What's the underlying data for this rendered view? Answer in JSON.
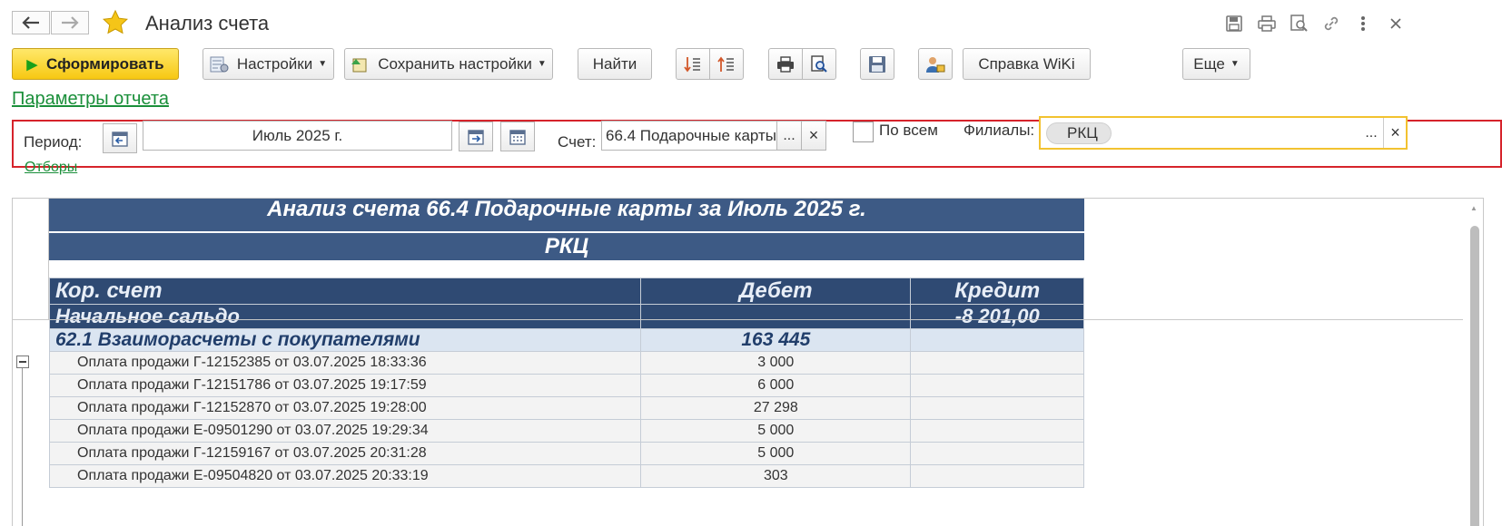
{
  "window": {
    "title": "Анализ счета",
    "title_icons": [
      "save-icon",
      "print-icon",
      "preview-icon",
      "link-icon",
      "more-vertical-icon",
      "close-icon"
    ]
  },
  "toolbar": {
    "generate": "Сформировать",
    "settings": "Настройки",
    "save_settings": "Сохранить настройки",
    "find": "Найти",
    "wiki": "Справка WiKi",
    "more": "Еще"
  },
  "links": {
    "report_params": "Параметры отчета",
    "filters": "Отборы"
  },
  "params": {
    "period_label": "Период:",
    "period_value": "Июль 2025 г.",
    "account_label": "Счет:",
    "account_value": "66.4 Подарочные карты",
    "all_label": "По всем",
    "branches_label": "Филиалы:",
    "branch_tag": "РКЦ",
    "ellipsis": "...",
    "clear": "×"
  },
  "report": {
    "title": "Анализ счета 66.4 Подарочные карты за Июль 2025 г.",
    "subtitle": "РКЦ",
    "columns": [
      "Кор. счет",
      "Дебет",
      "Кредит"
    ],
    "opening_balance": {
      "label": "Начальное сальдо",
      "debit": "",
      "credit": "-8 201,00"
    },
    "group": {
      "label": "62.1 Взаиморасчеты с покупателями",
      "debit": "163 445",
      "credit": ""
    },
    "rows": [
      {
        "label": "Оплата продажи Г-12152385 от 03.07.2025 18:33:36",
        "debit": "3 000",
        "credit": ""
      },
      {
        "label": "Оплата продажи Г-12151786 от 03.07.2025 19:17:59",
        "debit": "6 000",
        "credit": ""
      },
      {
        "label": "Оплата продажи Г-12152870 от 03.07.2025 19:28:00",
        "debit": "27 298",
        "credit": ""
      },
      {
        "label": "Оплата продажи Е-09501290 от 03.07.2025 19:29:34",
        "debit": "5 000",
        "credit": ""
      },
      {
        "label": "Оплата продажи Г-12159167 от 03.07.2025 20:31:28",
        "debit": "5 000",
        "credit": ""
      },
      {
        "label": "Оплата продажи Е-09504820 от 03.07.2025 20:33:19",
        "debit": "303",
        "credit": ""
      }
    ]
  },
  "colors": {
    "accent": "#f7c812",
    "header": "#3d5a85",
    "link": "#1a8f3a",
    "highlight": "#d6232b"
  }
}
